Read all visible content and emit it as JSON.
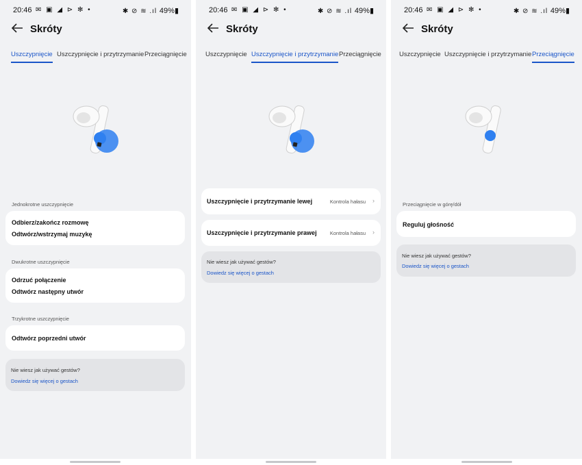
{
  "colors": {
    "accent": "#1a55c8",
    "background": "#f1f2f4",
    "card": "#ffffff",
    "help_card": "#e3e4e7",
    "earbud_blue": "#2f80f0"
  },
  "status": {
    "time": "20:46",
    "left_icons": "✉ ▣ ◢ ⊳ ✻ •",
    "right_icons": "✱ ⊘ ≋ .ıl",
    "battery": "49%▮"
  },
  "header": {
    "back_icon": "arrow-left-icon",
    "title": "Skróty"
  },
  "tabs": [
    "Uszczypnięcie",
    "Uszczypnięcie i przytrzymanie",
    "Przeciągnięcie"
  ],
  "screens": [
    {
      "active_tab": 0,
      "groups": [
        {
          "label": "Jednokrotne uszczypnięcie",
          "lines": [
            "Odbierz/zakończ rozmowę",
            "Odtwórz/wstrzymaj muzykę"
          ]
        },
        {
          "label": "Dwukrotne uszczypnięcie",
          "lines": [
            "Odrzuć połączenie",
            "Odtwórz następny utwór"
          ]
        },
        {
          "label": "Trzykrotne uszczypnięcie",
          "lines": [
            "Odtwórz poprzedni utwór"
          ]
        }
      ],
      "help": {
        "question": "Nie wiesz jak używać gestów?",
        "link": "Dowiedz się więcej o gestach"
      }
    },
    {
      "active_tab": 1,
      "rows": [
        {
          "label": "Uszczypnięcie i przytrzymanie lewej",
          "value": "Kontrola hałasu"
        },
        {
          "label": "Uszczypnięcie i przytrzymanie prawej",
          "value": "Kontrola hałasu"
        }
      ],
      "help": {
        "question": "Nie wiesz jak używać gestów?",
        "link": "Dowiedz się więcej o gestach"
      }
    },
    {
      "active_tab": 2,
      "groups": [
        {
          "label": "Przeciągnięcie w górę/dół",
          "lines": [
            "Reguluj głośność"
          ]
        }
      ],
      "help": {
        "question": "Nie wiesz jak używać gestów?",
        "link": "Dowiedz się więcej o gestach"
      }
    }
  ]
}
